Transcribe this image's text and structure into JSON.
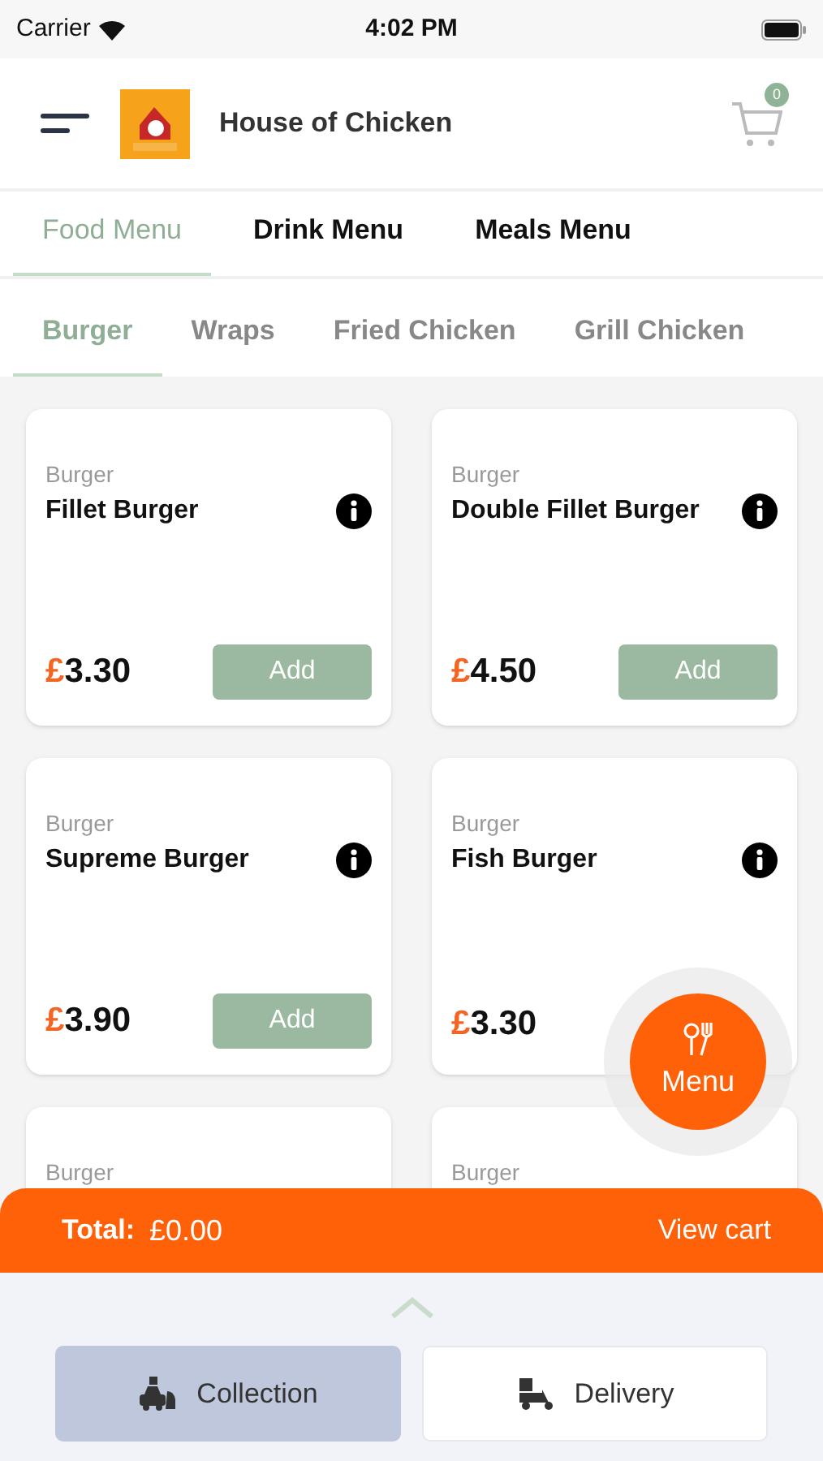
{
  "status_bar": {
    "carrier": "Carrier",
    "time": "4:02 PM"
  },
  "header": {
    "title": "House of Chicken",
    "cart_count": "0"
  },
  "menu_tabs": [
    {
      "label": "Food Menu",
      "selected": true
    },
    {
      "label": "Drink Menu",
      "selected": false
    },
    {
      "label": "Meals Menu",
      "selected": false
    }
  ],
  "category_tabs": [
    {
      "label": "Burger",
      "selected": true
    },
    {
      "label": "Wraps",
      "selected": false
    },
    {
      "label": "Fried Chicken",
      "selected": false
    },
    {
      "label": "Grill Chicken",
      "selected": false
    }
  ],
  "products": [
    {
      "category": "Burger",
      "name": "Fillet Burger",
      "currency": "£",
      "price": "3.30",
      "button": "Add"
    },
    {
      "category": "Burger",
      "name": "Double Fillet Burger",
      "currency": "£",
      "price": "4.50",
      "button": "Add"
    },
    {
      "category": "Burger",
      "name": "Supreme Burger",
      "currency": "£",
      "price": "3.90",
      "button": "Add"
    },
    {
      "category": "Burger",
      "name": "Fish Burger",
      "currency": "£",
      "price": "3.30"
    },
    {
      "category": "Burger"
    },
    {
      "category": "Burger"
    }
  ],
  "menu_button": {
    "label": "Menu"
  },
  "cart_bar": {
    "total_label": "Total:",
    "total": "£0.00",
    "view_cart": "View cart"
  },
  "order_types": [
    {
      "kind": "collection",
      "label": "Collection",
      "selected": true
    },
    {
      "kind": "delivery",
      "label": "Delivery",
      "selected": false
    }
  ]
}
